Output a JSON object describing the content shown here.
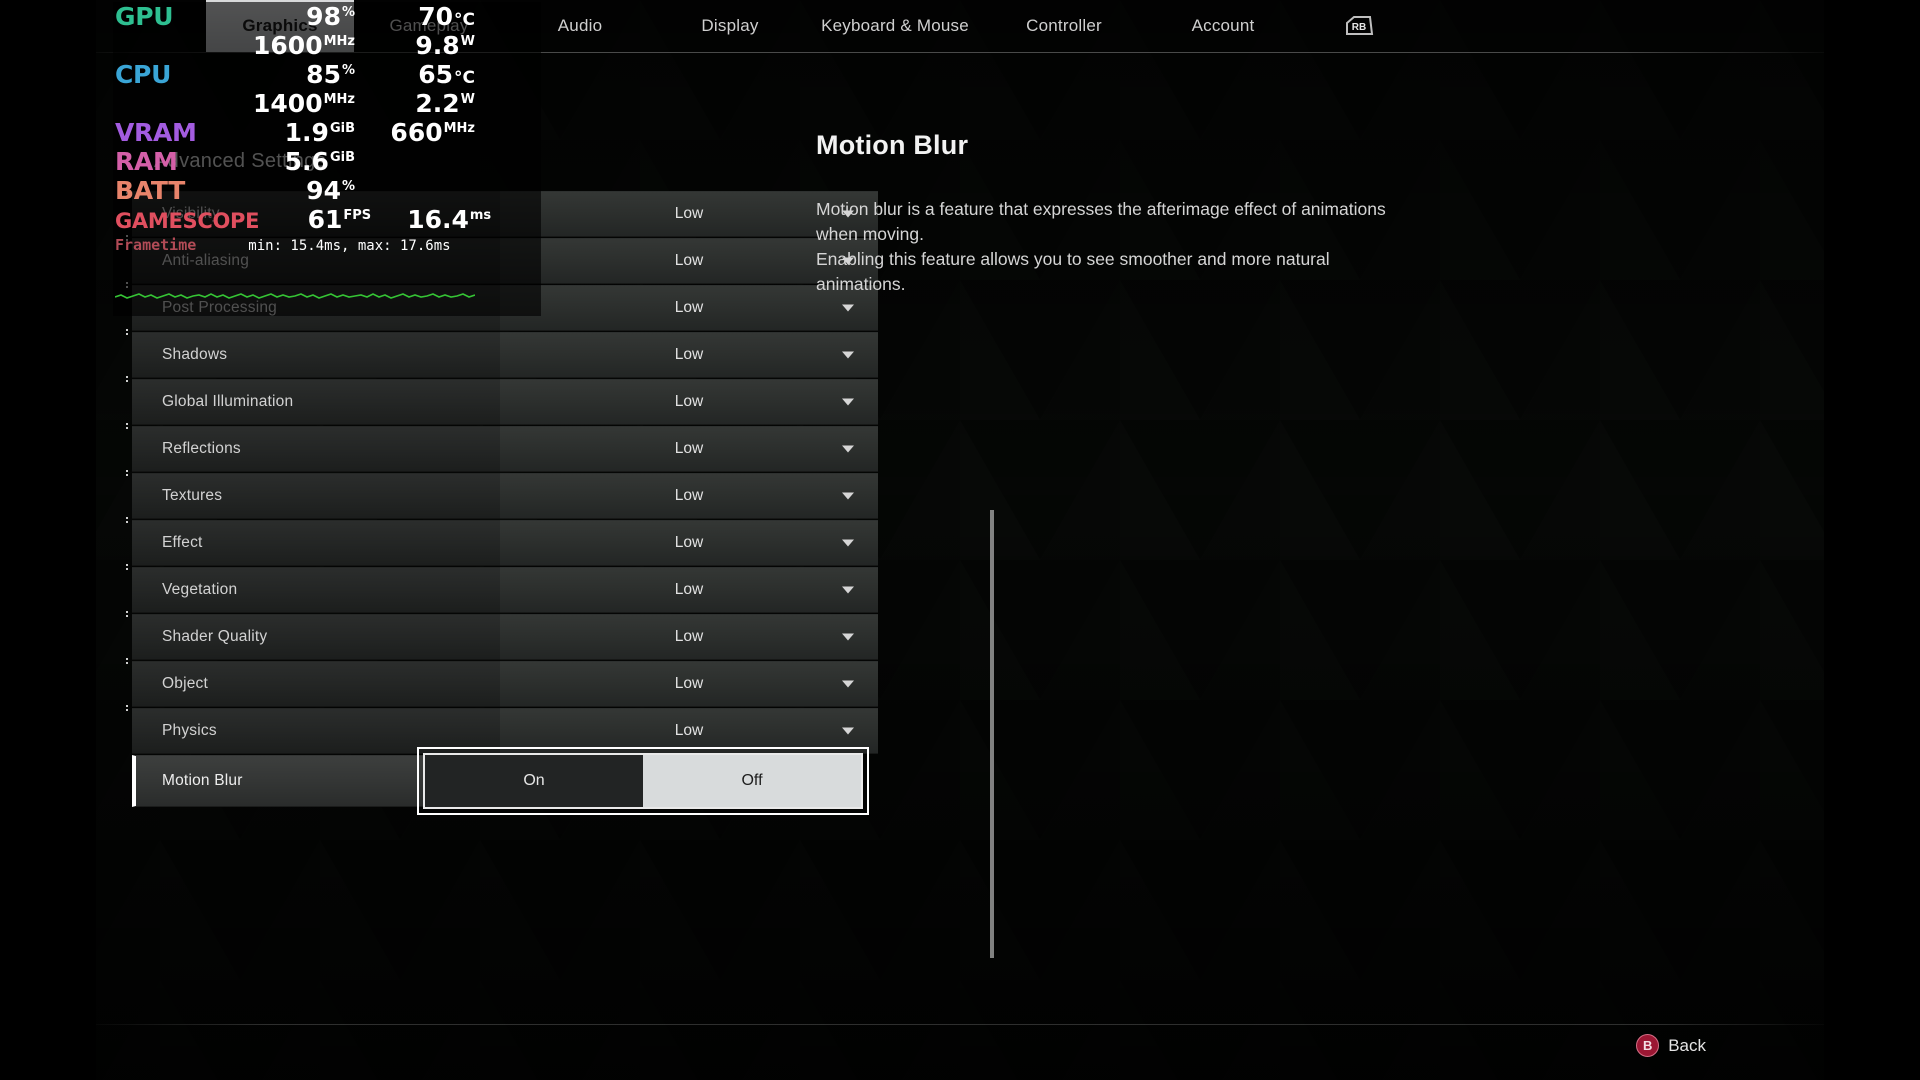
{
  "nav": {
    "tabs": [
      {
        "label": "Graphics",
        "active": true
      },
      {
        "label": "Gameplay",
        "active": false
      },
      {
        "label": "Audio",
        "active": false
      },
      {
        "label": "Display",
        "active": false
      },
      {
        "label": "Keyboard & Mouse",
        "active": false
      },
      {
        "label": "Controller",
        "active": false
      },
      {
        "label": "Account",
        "active": false
      }
    ],
    "shoulder_button": "RB"
  },
  "section": {
    "title": "Advanced Settings"
  },
  "settings": {
    "rows": [
      {
        "label": "Visibility",
        "value": "Low",
        "control": "dropdown"
      },
      {
        "label": "Anti-aliasing",
        "value": "Low",
        "control": "dropdown"
      },
      {
        "label": "Post Processing",
        "value": "Low",
        "control": "dropdown"
      },
      {
        "label": "Shadows",
        "value": "Low",
        "control": "dropdown"
      },
      {
        "label": "Global Illumination",
        "value": "Low",
        "control": "dropdown"
      },
      {
        "label": "Reflections",
        "value": "Low",
        "control": "dropdown"
      },
      {
        "label": "Textures",
        "value": "Low",
        "control": "dropdown"
      },
      {
        "label": "Effect",
        "value": "Low",
        "control": "dropdown"
      },
      {
        "label": "Vegetation",
        "value": "Low",
        "control": "dropdown"
      },
      {
        "label": "Shader Quality",
        "value": "Low",
        "control": "dropdown"
      },
      {
        "label": "Object",
        "value": "Low",
        "control": "dropdown"
      },
      {
        "label": "Physics",
        "value": "Low",
        "control": "dropdown"
      }
    ],
    "selected_row": {
      "label": "Motion Blur",
      "control": "toggle",
      "options": [
        "On",
        "Off"
      ],
      "selected_option": "Off"
    }
  },
  "description": {
    "title": "Motion Blur",
    "line1": "Motion blur is a feature that expresses the afterimage effect of animations",
    "line2": "when moving.",
    "line3": "Enabling this feature allows you to see smoother and more natural",
    "line4": "animations."
  },
  "footer": {
    "back_button_glyph": "B",
    "back_label": "Back"
  },
  "performance_overlay": {
    "gpu": {
      "name": "GPU",
      "color": "#2ebf91",
      "usage": "98",
      "usage_unit": "%",
      "temperature": "70",
      "temperature_unit": "°C",
      "clock": "1600",
      "clock_unit": "MHz",
      "power": "9.8",
      "power_unit": "W"
    },
    "cpu": {
      "name": "CPU",
      "color": "#3aa5d6",
      "usage": "85",
      "usage_unit": "%",
      "temperature": "65",
      "temperature_unit": "°C",
      "clock": "1400",
      "clock_unit": "MHz",
      "power": "2.2",
      "power_unit": "W"
    },
    "vram": {
      "name": "VRAM",
      "color": "#a35ce0",
      "value": "1.9",
      "unit": "GiB",
      "clock": "660",
      "clock_unit": "MHz"
    },
    "ram": {
      "name": "RAM",
      "color": "#d45fa8",
      "value": "5.6",
      "unit": "GiB"
    },
    "batt": {
      "name": "BATT",
      "color": "#e8846b",
      "value": "94",
      "unit": "%"
    },
    "gamescope": {
      "name": "GAMESCOPE",
      "color": "#e04f5f",
      "fps": "61",
      "fps_unit": "FPS",
      "frametime": "16.4",
      "frametime_unit": "ms"
    },
    "frametime_graph": {
      "label": "Frametime",
      "label_color": "#b14b56",
      "minmax": "min: 15.4ms, max: 17.6ms",
      "line_color": "#35c435"
    }
  }
}
